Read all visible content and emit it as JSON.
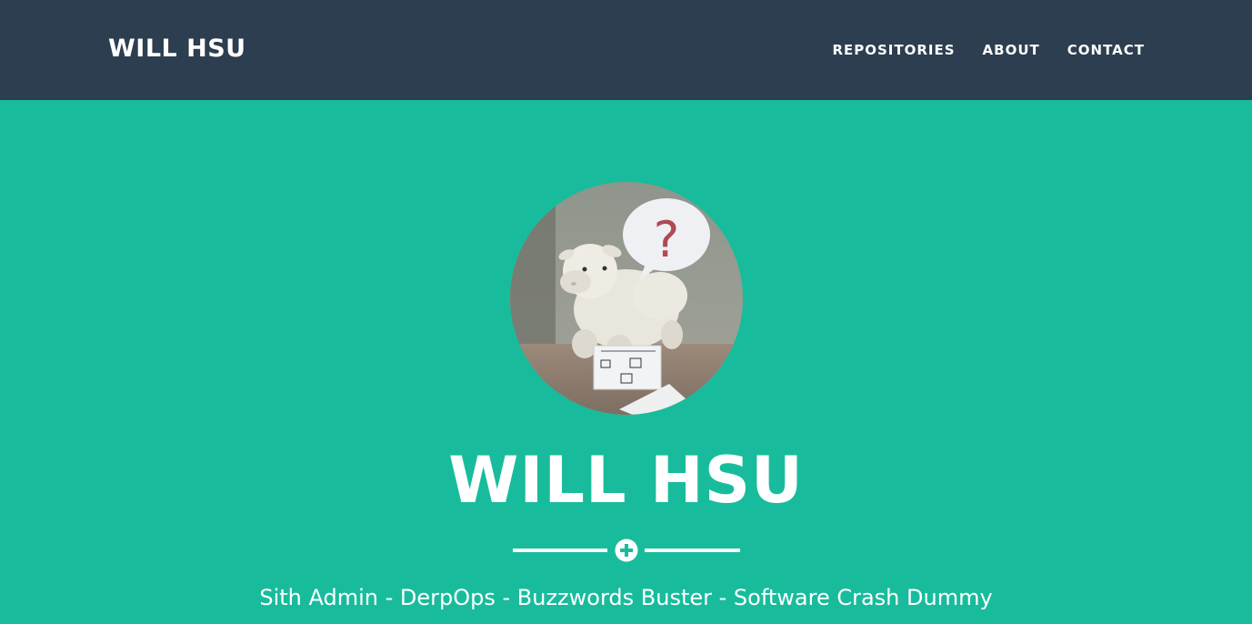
{
  "navbar": {
    "brand": "WILL HSU",
    "links": [
      {
        "label": "REPOSITORIES"
      },
      {
        "label": "ABOUT"
      },
      {
        "label": "CONTACT"
      }
    ]
  },
  "header": {
    "title": "WILL HSU",
    "tagline": "Sith Admin - DerpOps - Buzzwords Buster - Software Crash Dummy",
    "avatar_icon": "profile-photo-sheep-with-question-bubble",
    "divider_icon": "plus-circle-icon"
  },
  "colors": {
    "navbar_bg": "#2c3e50",
    "header_bg": "#18bc9c",
    "text": "#ffffff"
  }
}
